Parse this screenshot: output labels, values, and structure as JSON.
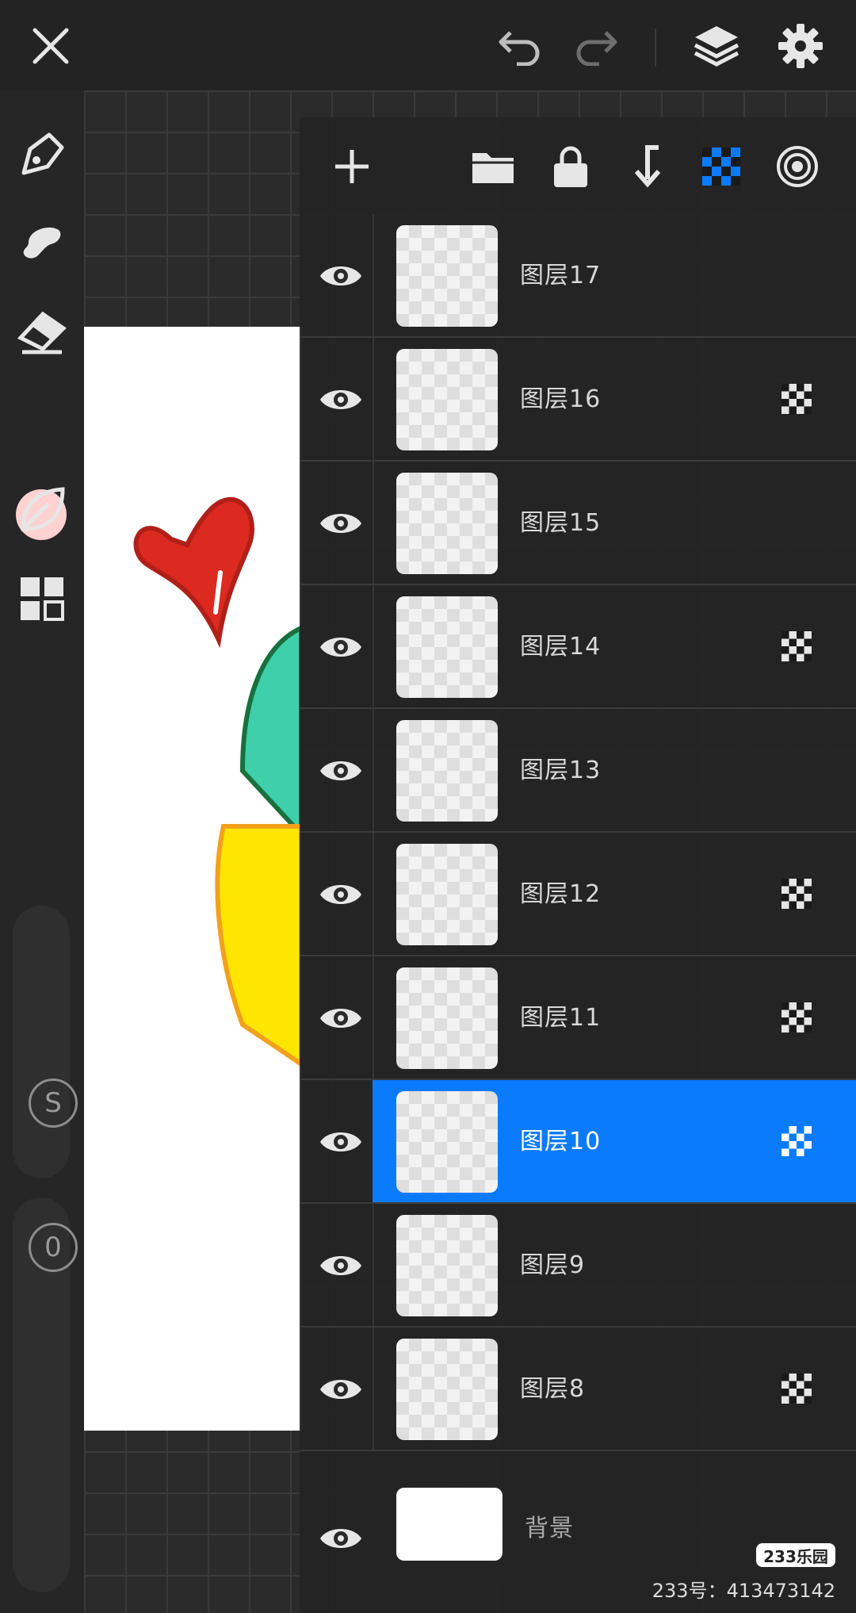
{
  "toolbar": {
    "close_icon": "close-icon",
    "undo_icon": "undo-icon",
    "redo_icon": "redo-icon",
    "layers_icon": "layers-icon",
    "settings_icon": "gear-icon"
  },
  "tools": {
    "brush": "pen-icon",
    "smudge": "smudge-icon",
    "eraser": "eraser-icon",
    "color": "#ffd1d1",
    "leaf": "leaf-icon",
    "grid": "grid-icon",
    "size_label": "S",
    "opacity_label": "0"
  },
  "layers_panel": {
    "actions": [
      "add-layer",
      "folder",
      "lock",
      "merge-down",
      "alpha-mask",
      "blend-mode"
    ],
    "layers": [
      {
        "name": "图层17",
        "mask": false,
        "selected": false
      },
      {
        "name": "图层16",
        "mask": true,
        "selected": false
      },
      {
        "name": "图层15",
        "mask": false,
        "selected": false
      },
      {
        "name": "图层14",
        "mask": true,
        "selected": false
      },
      {
        "name": "图层13",
        "mask": false,
        "selected": false
      },
      {
        "name": "图层12",
        "mask": true,
        "selected": false
      },
      {
        "name": "图层11",
        "mask": true,
        "selected": false
      },
      {
        "name": "图层10",
        "mask": true,
        "selected": true
      },
      {
        "name": "图层9",
        "mask": false,
        "selected": false
      },
      {
        "name": "图层8",
        "mask": true,
        "selected": false
      }
    ],
    "background_label": "背景"
  },
  "watermark": {
    "badge": "233乐园",
    "id_text": "233号：413473142"
  },
  "colors": {
    "accent": "#0a7bfd"
  }
}
